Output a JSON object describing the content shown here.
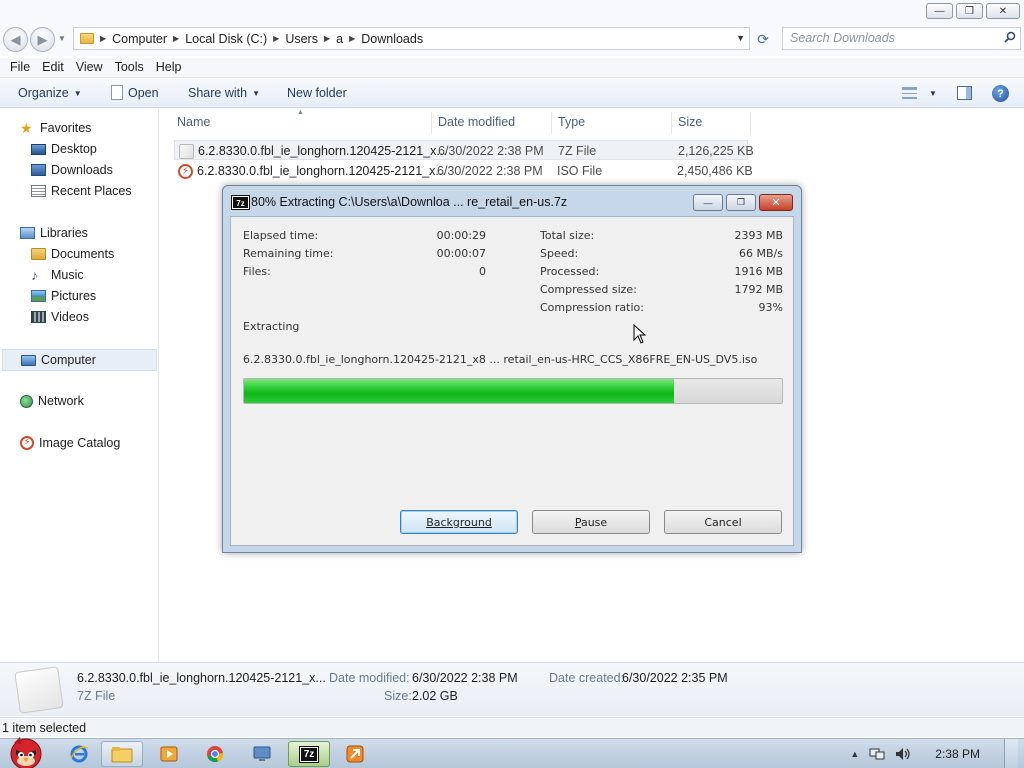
{
  "window": {
    "minimize_glyph": "—",
    "maximize_glyph": "❐",
    "close_glyph": "✕"
  },
  "address": {
    "breadcrumbs": [
      "Computer",
      "Local Disk (C:)",
      "Users",
      "a",
      "Downloads"
    ],
    "search_placeholder": "Search Downloads"
  },
  "menu": {
    "items": [
      "File",
      "Edit",
      "View",
      "Tools",
      "Help"
    ]
  },
  "toolbar": {
    "organize": "Organize",
    "open": "Open",
    "share_with": "Share with",
    "new_folder": "New folder"
  },
  "nav": {
    "favorites": "Favorites",
    "desktop": "Desktop",
    "downloads": "Downloads",
    "recent_places": "Recent Places",
    "libraries": "Libraries",
    "documents": "Documents",
    "music": "Music",
    "pictures": "Pictures",
    "videos": "Videos",
    "computer": "Computer",
    "network": "Network",
    "image_catalog": "Image Catalog"
  },
  "filelist": {
    "columns": {
      "name": "Name",
      "date": "Date modified",
      "type": "Type",
      "size": "Size"
    },
    "rows": [
      {
        "name": "6.2.8330.0.fbl_ie_longhorn.120425-2121_x...",
        "date": "6/30/2022 2:38 PM",
        "type": "7Z File",
        "size": "2,126,225 KB",
        "selected": true
      },
      {
        "name": "6.2.8330.0.fbl_ie_longhorn.120425-2121_x...",
        "date": "6/30/2022 2:38 PM",
        "type": "ISO File",
        "size": "2,450,486 KB",
        "selected": false
      }
    ]
  },
  "details": {
    "filename": "6.2.8330.0.fbl_ie_longhorn.120425-2121_x...",
    "filetype": "7Z File",
    "date_modified_label": "Date modified:",
    "date_modified": "6/30/2022 2:38 PM",
    "size_label": "Size:",
    "size": "2.02 GB",
    "date_created_label": "Date created:",
    "date_created": "6/30/2022 2:35 PM"
  },
  "status": {
    "text": "1 item selected"
  },
  "dialog": {
    "title": "80% Extracting C:\\Users\\a\\Downloa ... re_retail_en-us.7z",
    "app_icon_text": "7z",
    "elapsed_label": "Elapsed time:",
    "elapsed_value": "00:00:29",
    "remaining_label": "Remaining time:",
    "remaining_value": "00:00:07",
    "files_label": "Files:",
    "files_value": "0",
    "total_label": "Total size:",
    "total_value": "2393 MB",
    "speed_label": "Speed:",
    "speed_value": "66 MB/s",
    "processed_label": "Processed:",
    "processed_value": "1916 MB",
    "compressed_label": "Compressed size:",
    "compressed_value": "1792 MB",
    "ratio_label": "Compression ratio:",
    "ratio_value": "93%",
    "action": "Extracting",
    "current_file": "6.2.8330.0.fbl_ie_longhorn.120425-2121_x8 ... retail_en-us-HRC_CCS_X86FRE_EN-US_DV5.iso",
    "progress_fraction": 0.8,
    "buttons": {
      "background": "Background",
      "pause": "Pause",
      "cancel": "Cancel"
    }
  },
  "taskbar": {
    "clock": "2:38 PM",
    "tray_arrow": "▲"
  },
  "colors": {
    "progress_green": "#13b51f",
    "close_red": "#c7402b",
    "accent_blue": "#3b6fb6"
  }
}
